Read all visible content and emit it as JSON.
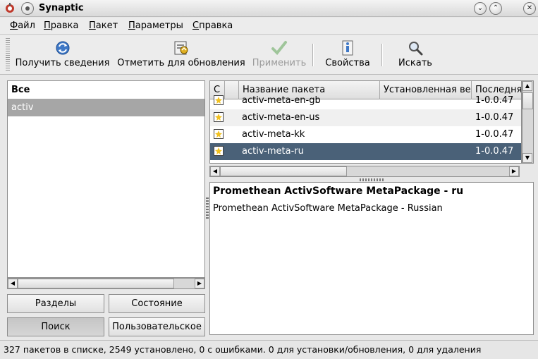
{
  "window": {
    "title": "Synaptic"
  },
  "menu": [
    {
      "label": "Файл"
    },
    {
      "label": "Правка"
    },
    {
      "label": "Пакет"
    },
    {
      "label": "Параметры"
    },
    {
      "label": "Справка"
    }
  ],
  "toolbar": {
    "reload": {
      "label": "Получить сведения",
      "icon": "refresh-icon"
    },
    "mark_upgrades": {
      "label": "Отметить для обновления",
      "icon": "mark-upgrades-icon"
    },
    "apply": {
      "label": "Применить",
      "icon": "checkmark-icon",
      "disabled": true
    },
    "properties": {
      "label": "Свойства",
      "icon": "properties-icon"
    },
    "search": {
      "label": "Искать",
      "icon": "magnifier-icon"
    }
  },
  "filter_list": {
    "items": [
      {
        "label": "Все",
        "bold": true,
        "selected": false
      },
      {
        "label": "activ",
        "bold": false,
        "selected": true
      }
    ]
  },
  "view_buttons": {
    "sections": "Разделы",
    "status": "Состояние",
    "search": "Поиск",
    "custom": "Пользовательское"
  },
  "package_table": {
    "columns": [
      "С",
      "",
      "Название пакета",
      "Установленная ве",
      "Последня"
    ],
    "rows": [
      {
        "name": "activ-meta-en-gb",
        "version": "1-0.0.47",
        "selected": false
      },
      {
        "name": "activ-meta-en-us",
        "version": "1-0.0.47",
        "selected": false
      },
      {
        "name": "activ-meta-kk",
        "version": "1-0.0.47",
        "selected": false
      },
      {
        "name": "activ-meta-ru",
        "version": "1-0.0.47",
        "selected": true
      }
    ]
  },
  "description": {
    "title": "Promethean ActivSoftware MetaPackage - ru",
    "text": "Promethean ActivSoftware MetaPackage - Russian"
  },
  "statusbar": {
    "text": "327 пакетов в списке, 2549 установлено, 0 с ошибками. 0 для установки/обновления, 0 для удаления"
  },
  "colors": {
    "selection": "#4a6178",
    "left_selection": "#a6a6a6"
  }
}
